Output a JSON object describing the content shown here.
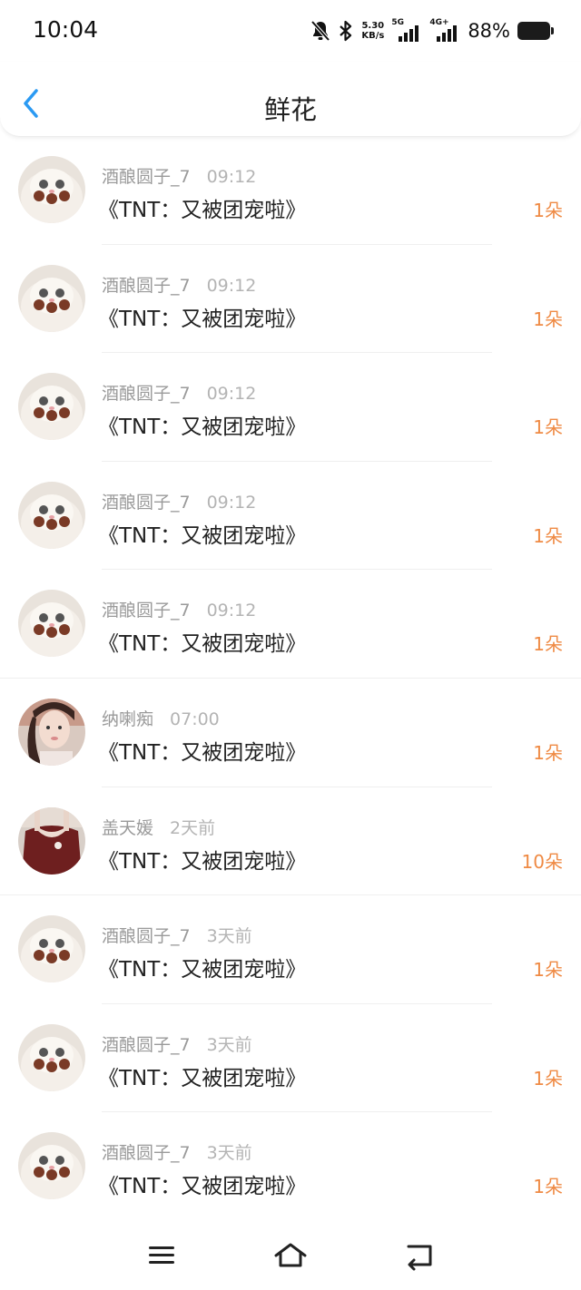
{
  "status_bar": {
    "time": "10:04",
    "speed_value": "5.30",
    "speed_unit": "KB/s",
    "network_1": "5G",
    "network_2": "4G+",
    "battery": "88%",
    "icons": [
      "mute-bell-icon",
      "bluetooth-icon",
      "signal-icon",
      "signal-icon",
      "battery-icon"
    ]
  },
  "header": {
    "title": "鲜花",
    "back_icon": "chevron-left-icon"
  },
  "rows": [
    {
      "user": "酒酿圆子_7",
      "time": "09:12",
      "title": "《TNT：又被团宠啦》",
      "count": "1朵",
      "avatar": "cat"
    },
    {
      "user": "酒酿圆子_7",
      "time": "09:12",
      "title": "《TNT：又被团宠啦》",
      "count": "1朵",
      "avatar": "cat"
    },
    {
      "user": "酒酿圆子_7",
      "time": "09:12",
      "title": "《TNT：又被团宠啦》",
      "count": "1朵",
      "avatar": "cat"
    },
    {
      "user": "酒酿圆子_7",
      "time": "09:12",
      "title": "《TNT：又被团宠啦》",
      "count": "1朵",
      "avatar": "cat"
    },
    {
      "user": "酒酿圆子_7",
      "time": "09:12",
      "title": "《TNT：又被团宠啦》",
      "count": "1朵",
      "avatar": "cat"
    },
    {
      "user": "纳喇痴",
      "time": "07:00",
      "title": "《TNT：又被团宠啦》",
      "count": "1朵",
      "avatar": "girl"
    },
    {
      "user": "盖天媛",
      "time": "2天前",
      "title": "《TNT：又被团宠啦》",
      "count": "10朵",
      "avatar": "dress"
    },
    {
      "user": "酒酿圆子_7",
      "time": "3天前",
      "title": "《TNT：又被团宠啦》",
      "count": "1朵",
      "avatar": "cat"
    },
    {
      "user": "酒酿圆子_7",
      "time": "3天前",
      "title": "《TNT：又被团宠啦》",
      "count": "1朵",
      "avatar": "cat"
    },
    {
      "user": "酒酿圆子_7",
      "time": "3天前",
      "title": "《TNT：又被团宠啦》",
      "count": "1朵",
      "avatar": "cat"
    }
  ],
  "nav": {
    "icons": [
      "menu-icon",
      "home-icon",
      "back-icon"
    ]
  },
  "colors": {
    "accent": "#2b9af3",
    "count": "#ef8a44",
    "meta": "#9a9a9a"
  }
}
